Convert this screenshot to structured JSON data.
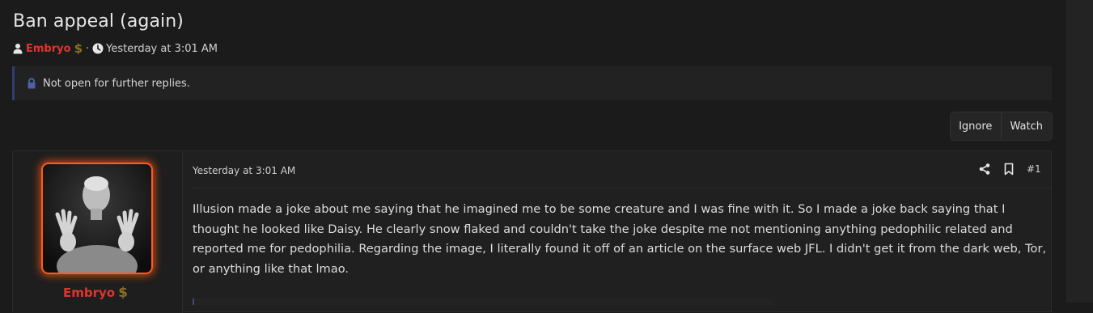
{
  "thread": {
    "title": "Ban appeal (again)",
    "author": "Embryo",
    "author_badge": "$",
    "separator": "·",
    "date": "Yesterday at 3:01 AM"
  },
  "notice": {
    "text": "Not open for further replies."
  },
  "actions": {
    "ignore_label": "Ignore",
    "watch_label": "Watch"
  },
  "post": {
    "author": "Embryo",
    "author_badge": "$",
    "date": "Yesterday at 3:01 AM",
    "number": "#1",
    "body": "Illusion made a joke about me saying that he imagined me to be some creature and I was fine with it. So I made a joke back saying that I thought he looked like Daisy. He clearly snow flaked and couldn't take the joke despite me not mentioning anything pedophilic related and reported me for pedophilia. Regarding the image, I literally found it off of an article on the surface web JFL. I didn't get it from the dark web, Tor, or anything like that lmao."
  },
  "icons": {
    "user": "user-icon",
    "clock": "clock-icon",
    "lock": "lock-icon",
    "share": "share-icon",
    "bookmark": "bookmark-icon"
  },
  "colors": {
    "background": "#1b1b1b",
    "author_name": "#e0352b",
    "avatar_glow": "#ff5a1f",
    "notice_accent": "#2f3f6e"
  }
}
